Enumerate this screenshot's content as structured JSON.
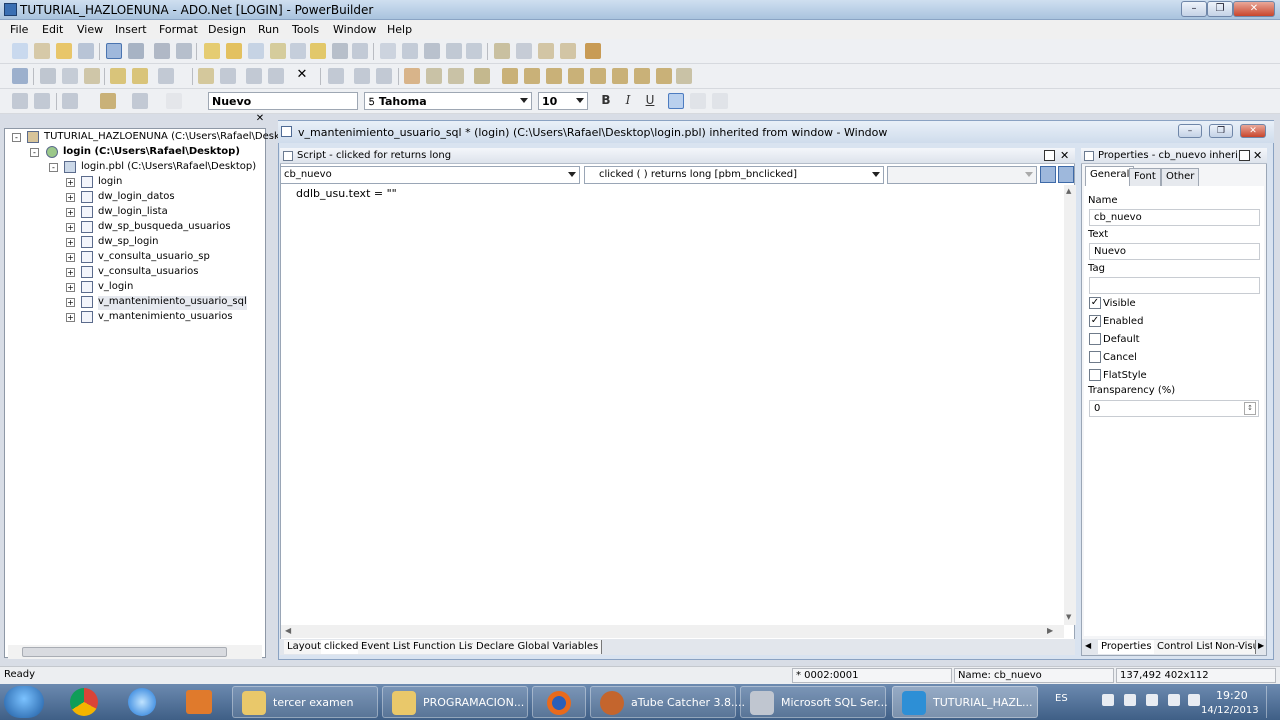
{
  "window": {
    "title": "TUTURIAL_HAZLOENUNA - ADO.Net [LOGIN] - PowerBuilder"
  },
  "menu": [
    "File",
    "Edit",
    "View",
    "Insert",
    "Format",
    "Design",
    "Run",
    "Tools",
    "Window",
    "Help"
  ],
  "format_toolbar": {
    "text_value": "Nuevo",
    "font": "Tahoma",
    "size": "10",
    "bold": "B",
    "italic": "I",
    "underline": "U"
  },
  "tree": {
    "workspace": "TUTURIAL_HAZLOENUNA (C:\\Users\\Rafael\\Deski",
    "target": "login (C:\\Users\\Rafael\\Desktop)",
    "library": "login.pbl (C:\\Users\\Rafael\\Desktop)",
    "items": [
      "login",
      "dw_login_datos",
      "dw_login_lista",
      "dw_sp_busqueda_usuarios",
      "dw_sp_login",
      "v_consulta_usuario_sp",
      "v_consulta_usuarios",
      "v_login",
      "v_mantenimiento_usuario_sql",
      "v_mantenimiento_usuarios"
    ]
  },
  "painter": {
    "title": "v_mantenimiento_usuario_sql * (login) (C:\\Users\\Rafael\\Desktop\\login.pbl) inherited from window - Window"
  },
  "script": {
    "title": "Script - clicked for  returns long",
    "object": "cb_nuevo",
    "event": "clicked ( )  returns long [pbm_bnclicked]",
    "code": "ddlb_usu.text = \"\""
  },
  "bottom_tabs": [
    "Layout",
    "clicked",
    "Event List",
    "Function List",
    "Declare Global Variables"
  ],
  "properties": {
    "title": "Properties - cb_nuevo  inherit",
    "tabs": [
      "General",
      "Font",
      "Other"
    ],
    "name_label": "Name",
    "name_value": "cb_nuevo",
    "text_label": "Text",
    "text_value": "Nuevo",
    "tag_label": "Tag",
    "tag_value": "",
    "checks": [
      {
        "label": "Visible",
        "checked": true
      },
      {
        "label": "Enabled",
        "checked": true
      },
      {
        "label": "Default",
        "checked": false
      },
      {
        "label": "Cancel",
        "checked": false
      },
      {
        "label": "FlatStyle",
        "checked": false
      }
    ],
    "transparency_label": "Transparency (%)",
    "transparency_value": "0",
    "bottom_tabs": [
      "Properties",
      "Control List",
      "Non-Visu"
    ]
  },
  "status": {
    "ready": "Ready",
    "pos": "* 0002:0001",
    "name": "Name: cb_nuevo",
    "coords": "137,492 402x112"
  },
  "taskbar": {
    "items": [
      "tercer examen",
      "PROGRAMACION...",
      "aTube Catcher 3.8....",
      "Microsoft SQL Ser...",
      "TUTURIAL_HAZL..."
    ],
    "lang": "ES",
    "time": "19:20",
    "date": "14/12/2013"
  }
}
